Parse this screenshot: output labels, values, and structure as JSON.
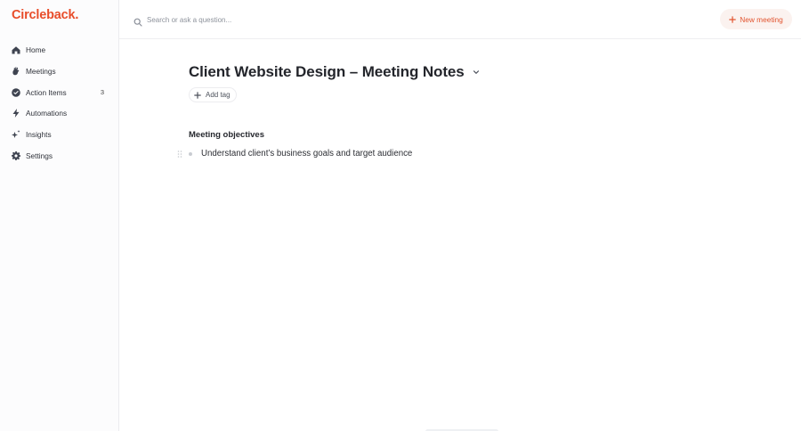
{
  "brand": {
    "name": "Circleback.",
    "color": "#e84d2a"
  },
  "sidebar": {
    "items": [
      {
        "label": "Home",
        "icon": "home-icon"
      },
      {
        "label": "Meetings",
        "icon": "meetings-icon"
      },
      {
        "label": "Action Items",
        "icon": "check-circle-icon",
        "count": "3"
      },
      {
        "label": "Automations",
        "icon": "lightning-icon"
      },
      {
        "label": "Insights",
        "icon": "sparkles-icon"
      },
      {
        "label": "Settings",
        "icon": "gear-icon"
      }
    ]
  },
  "header": {
    "search_placeholder": "Search or ask a question...",
    "new_meeting_label": "New meeting",
    "accent": "#e2542f"
  },
  "document": {
    "title": "Client Website Design – Meeting Notes",
    "add_tag_label": "Add tag",
    "sections": [
      {
        "heading": "Meeting objectives",
        "bullets": [
          "Understand client’s business goals and target audience"
        ]
      }
    ]
  }
}
